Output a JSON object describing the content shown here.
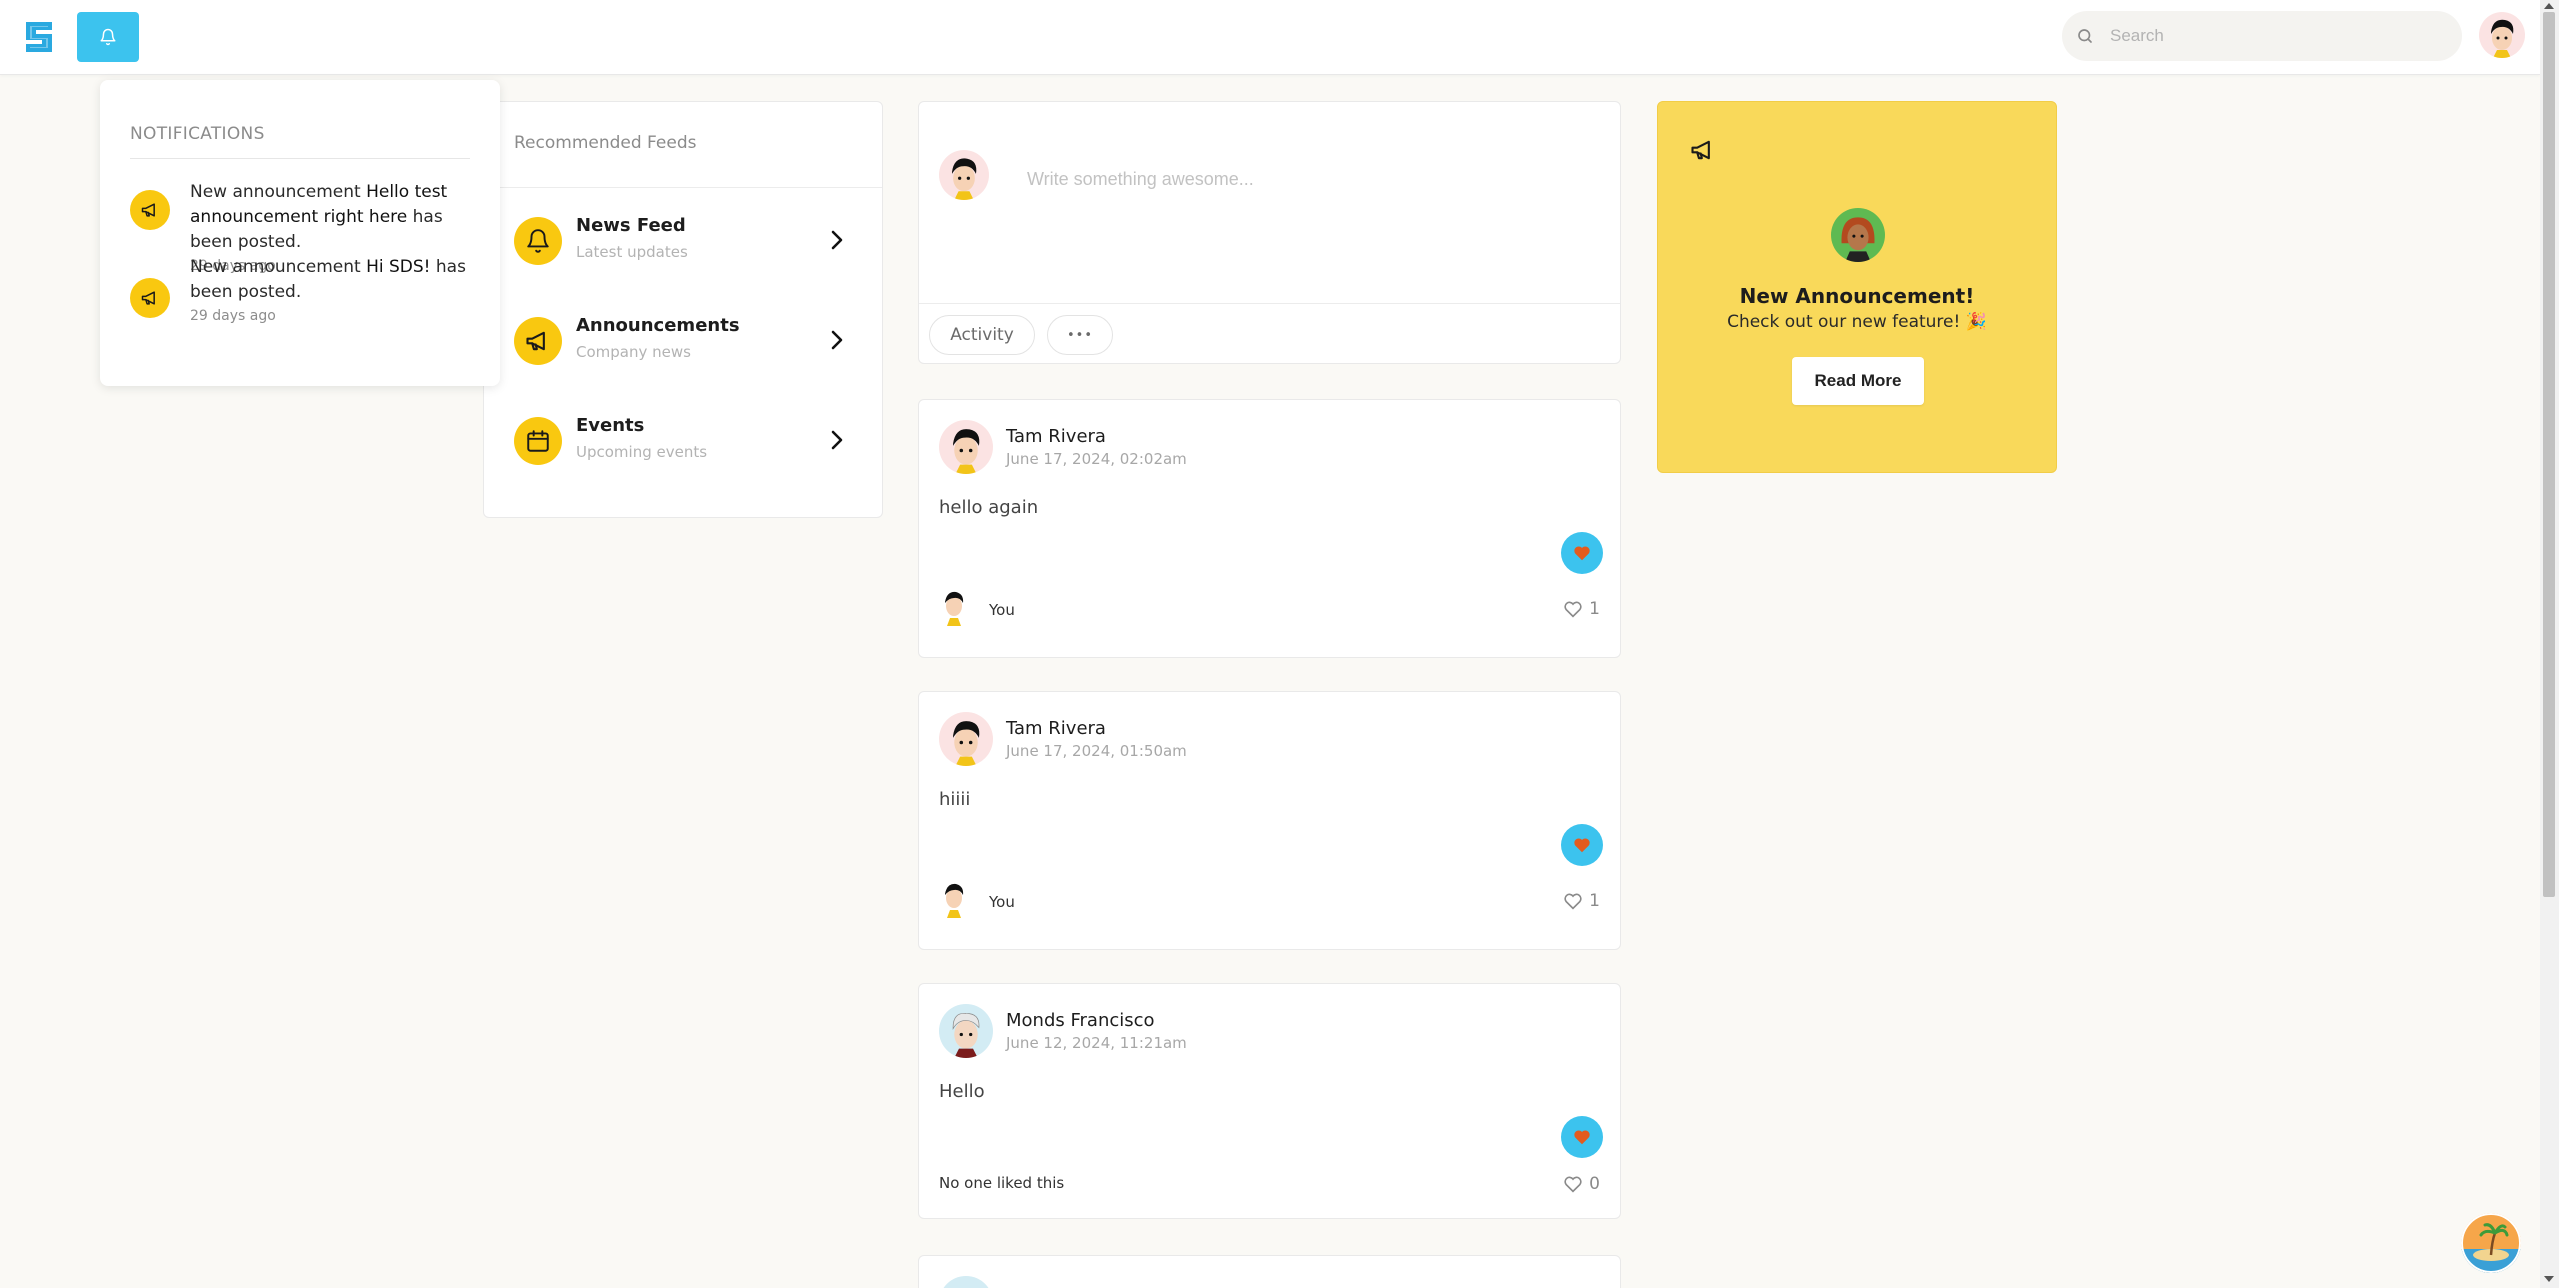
{
  "colors": {
    "accent": "#3cc3ee",
    "yellow": "#f9c810",
    "announcement_bg": "#f9d95a",
    "heart": "#e35b1e"
  },
  "header": {
    "search_placeholder": "Search",
    "icons": [
      "logo-icon",
      "bell-icon",
      "search-icon",
      "avatar"
    ]
  },
  "notifications": {
    "title": "NOTIFICATIONS",
    "items": [
      {
        "prefix": "New announcement ",
        "highlight": "Hello test announcement right here",
        "suffix": " has been posted.",
        "time": "29 days ago"
      },
      {
        "prefix": "New announcement ",
        "highlight": "Hi SDS!",
        "suffix": " has been posted.",
        "time": "29 days ago"
      }
    ]
  },
  "feeds": {
    "title": "Recommended Feeds",
    "items": [
      {
        "name": "News Feed",
        "subtitle": "Latest updates",
        "icon": "bell-icon"
      },
      {
        "name": "Announcements",
        "subtitle": "Company news",
        "icon": "megaphone-icon"
      },
      {
        "name": "Events",
        "subtitle": "Upcoming events",
        "icon": "calendar-icon"
      }
    ]
  },
  "composer": {
    "placeholder": "Write something awesome...",
    "activity_label": "Activity",
    "more_label": "•••"
  },
  "posts": [
    {
      "author": "Tam Rivera",
      "date": "June 17, 2024, 02:02am",
      "body": "hello again",
      "liked_by": "You",
      "likes": "1"
    },
    {
      "author": "Tam Rivera",
      "date": "June 17, 2024, 01:50am",
      "body": "hiiii",
      "liked_by": "You",
      "likes": "1"
    },
    {
      "author": "Monds Francisco",
      "date": "June 12, 2024, 11:21am",
      "body": "Hello",
      "liked_by": "No one liked this",
      "likes": "0"
    }
  ],
  "announcement": {
    "title": "New Announcement!",
    "subtitle": "Check out our new feature! 🎉",
    "button": "Read More"
  }
}
